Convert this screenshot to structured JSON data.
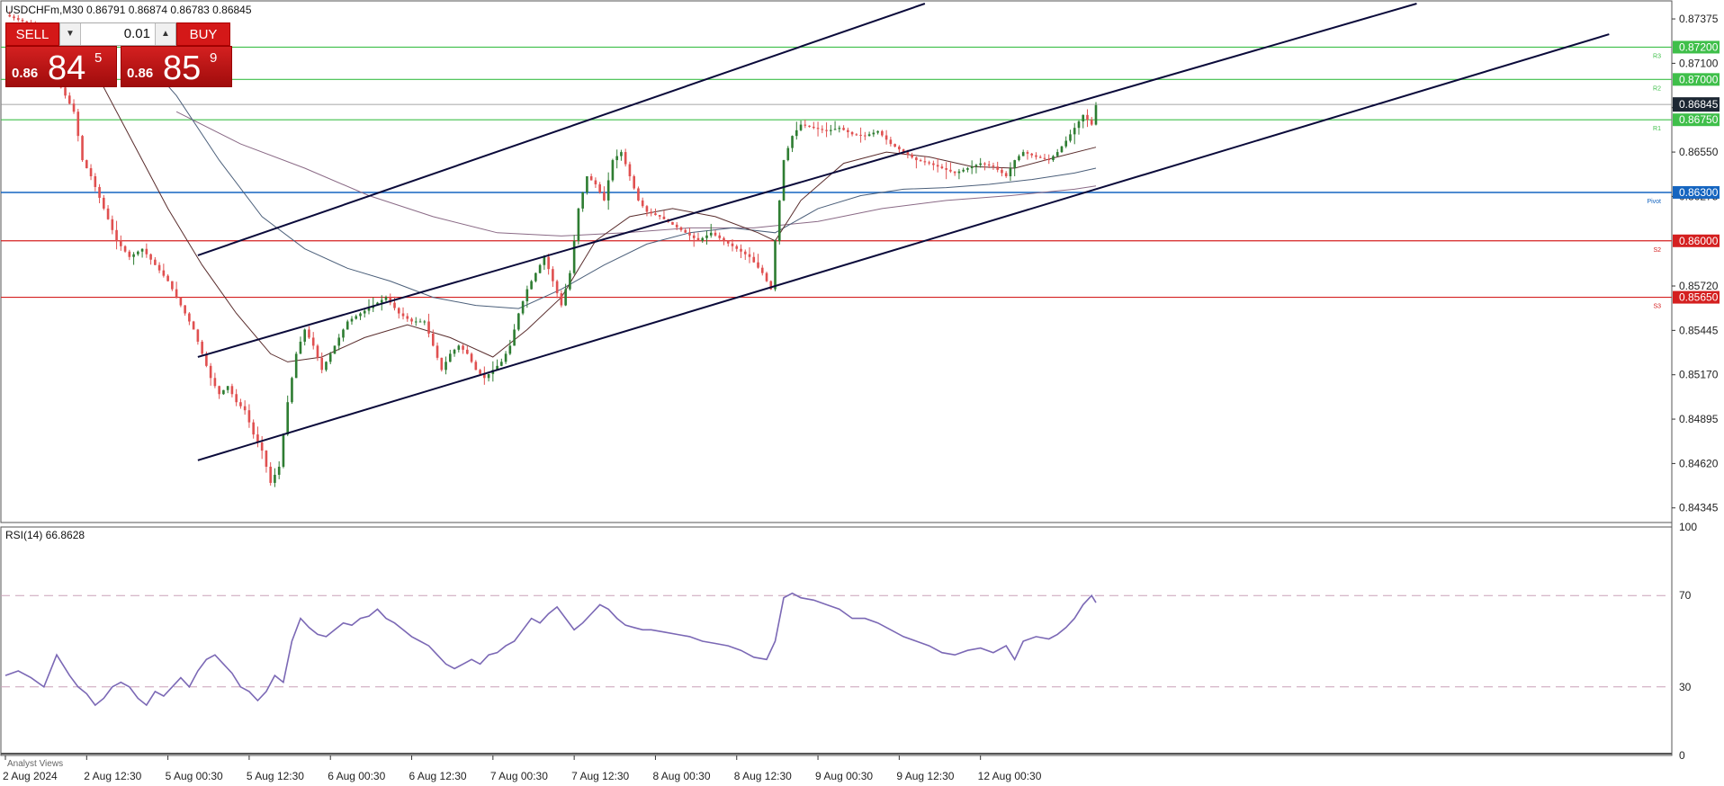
{
  "header": {
    "symbol_line": "USDCHFm,M30  0.86791 0.86874 0.86783 0.86845"
  },
  "trade_panel": {
    "sell_label": "SELL",
    "buy_label": "BUY",
    "lot_value": "0.01",
    "bid_small": "0.86",
    "bid_big": "84",
    "bid_sup": "5",
    "ask_small": "0.86",
    "ask_big": "85",
    "ask_sup": "9"
  },
  "rsi_panel": {
    "title": "RSI(14) 66.8628"
  },
  "footer": {
    "analyst_label": "Analyst Views"
  },
  "colors": {
    "bull": "#2e7d32",
    "bear": "#e05050",
    "resistance": "#3fbf4a",
    "support": "#d42020",
    "pivot": "#1565c0",
    "rsi": "#7b68b5",
    "channel": "#0a0a3a"
  },
  "chart_data": [
    {
      "type": "candlestick",
      "symbol": "USDCHFm",
      "timeframe": "M30",
      "ylim": [
        0.8426,
        0.8747
      ],
      "y_ticks": [
        "0.87375",
        "0.87100",
        "0.86825",
        "0.86550",
        "0.86275",
        "0.85720",
        "0.85445",
        "0.85170",
        "0.84895",
        "0.84620",
        "0.84345"
      ],
      "x_ticks": [
        "2 Aug 2024",
        "2 Aug 12:30",
        "5 Aug 00:30",
        "5 Aug 12:30",
        "6 Aug 00:30",
        "6 Aug 12:30",
        "7 Aug 00:30",
        "7 Aug 12:30",
        "8 Aug 00:30",
        "8 Aug 12:30",
        "9 Aug 00:30",
        "9 Aug 12:30",
        "12 Aug 00:30"
      ],
      "current_price": "0.86845",
      "levels": [
        {
          "name": "R3",
          "price": 0.872,
          "label": "0.87200",
          "role": "resistance"
        },
        {
          "name": "R2",
          "price": 0.87,
          "label": "0.87000",
          "role": "resistance"
        },
        {
          "name": "R1",
          "price": 0.8675,
          "label": "0.86750",
          "role": "resistance"
        },
        {
          "name": "Pivot",
          "price": 0.863,
          "label": "0.86300",
          "role": "pivot"
        },
        {
          "name": "S2",
          "price": 0.86,
          "label": "0.86000",
          "role": "support"
        },
        {
          "name": "S3",
          "price": 0.8565,
          "label": "0.85650",
          "role": "support"
        }
      ],
      "close_path": [
        [
          0,
          0.874
        ],
        [
          2,
          0.8738
        ],
        [
          4,
          0.8736
        ],
        [
          6,
          0.8734
        ],
        [
          8,
          0.8732
        ],
        [
          10,
          0.873
        ],
        [
          12,
          0.87
        ],
        [
          14,
          0.869
        ],
        [
          16,
          0.868
        ],
        [
          18,
          0.865
        ],
        [
          20,
          0.864
        ],
        [
          23,
          0.862
        ],
        [
          26,
          0.86
        ],
        [
          29,
          0.859
        ],
        [
          32,
          0.8595
        ],
        [
          35,
          0.8585
        ],
        [
          38,
          0.8575
        ],
        [
          41,
          0.856
        ],
        [
          44,
          0.8545
        ],
        [
          46,
          0.853
        ],
        [
          48,
          0.8515
        ],
        [
          50,
          0.8505
        ],
        [
          52,
          0.851
        ],
        [
          54,
          0.85
        ],
        [
          56,
          0.8495
        ],
        [
          58,
          0.848
        ],
        [
          60,
          0.847
        ],
        [
          62,
          0.845
        ],
        [
          64,
          0.846
        ],
        [
          66,
          0.85
        ],
        [
          68,
          0.853
        ],
        [
          70,
          0.8545
        ],
        [
          72,
          0.8535
        ],
        [
          74,
          0.852
        ],
        [
          76,
          0.853
        ],
        [
          78,
          0.854
        ],
        [
          80,
          0.855
        ],
        [
          83,
          0.8555
        ],
        [
          86,
          0.856
        ],
        [
          89,
          0.8565
        ],
        [
          92,
          0.8555
        ],
        [
          95,
          0.855
        ],
        [
          98,
          0.855
        ],
        [
          100,
          0.8535
        ],
        [
          102,
          0.852
        ],
        [
          104,
          0.853
        ],
        [
          106,
          0.8535
        ],
        [
          108,
          0.853
        ],
        [
          110,
          0.852
        ],
        [
          112,
          0.8515
        ],
        [
          114,
          0.852
        ],
        [
          116,
          0.8525
        ],
        [
          118,
          0.8535
        ],
        [
          120,
          0.8555
        ],
        [
          122,
          0.857
        ],
        [
          124,
          0.858
        ],
        [
          126,
          0.859
        ],
        [
          128,
          0.8575
        ],
        [
          130,
          0.856
        ],
        [
          132,
          0.858
        ],
        [
          134,
          0.862
        ],
        [
          136,
          0.864
        ],
        [
          138,
          0.8635
        ],
        [
          140,
          0.8625
        ],
        [
          142,
          0.865
        ],
        [
          144,
          0.8655
        ],
        [
          146,
          0.864
        ],
        [
          148,
          0.8625
        ],
        [
          150,
          0.8618
        ],
        [
          153,
          0.8615
        ],
        [
          156,
          0.861
        ],
        [
          159,
          0.8605
        ],
        [
          162,
          0.86
        ],
        [
          165,
          0.8605
        ],
        [
          168,
          0.86
        ],
        [
          171,
          0.8595
        ],
        [
          174,
          0.859
        ],
        [
          177,
          0.858
        ],
        [
          179,
          0.857
        ],
        [
          180,
          0.86
        ],
        [
          182,
          0.865
        ],
        [
          184,
          0.8665
        ],
        [
          186,
          0.8672
        ],
        [
          189,
          0.867
        ],
        [
          192,
          0.8668
        ],
        [
          195,
          0.867
        ],
        [
          198,
          0.8666
        ],
        [
          201,
          0.8665
        ],
        [
          204,
          0.8668
        ],
        [
          207,
          0.866
        ],
        [
          210,
          0.8655
        ],
        [
          213,
          0.865
        ],
        [
          216,
          0.8648
        ],
        [
          219,
          0.8645
        ],
        [
          222,
          0.8642
        ],
        [
          225,
          0.8645
        ],
        [
          228,
          0.8648
        ],
        [
          231,
          0.8646
        ],
        [
          234,
          0.864
        ],
        [
          236,
          0.865
        ],
        [
          238,
          0.8655
        ],
        [
          241,
          0.8652
        ],
        [
          244,
          0.865
        ],
        [
          246,
          0.8655
        ],
        [
          248,
          0.8662
        ],
        [
          250,
          0.867
        ],
        [
          252,
          0.8678
        ],
        [
          254,
          0.8672
        ],
        [
          255,
          0.8684
        ]
      ],
      "x_range": [
        0,
        255
      ],
      "ma_fast": [
        [
          14,
          0.8728
        ],
        [
          22,
          0.87
        ],
        [
          30,
          0.866
        ],
        [
          38,
          0.862
        ],
        [
          46,
          0.8585
        ],
        [
          54,
          0.8555
        ],
        [
          62,
          0.853
        ],
        [
          66,
          0.8525
        ],
        [
          74,
          0.8528
        ],
        [
          84,
          0.854
        ],
        [
          94,
          0.8548
        ],
        [
          104,
          0.854
        ],
        [
          114,
          0.8528
        ],
        [
          122,
          0.8545
        ],
        [
          130,
          0.8565
        ],
        [
          138,
          0.86
        ],
        [
          146,
          0.8615
        ],
        [
          156,
          0.862
        ],
        [
          166,
          0.8615
        ],
        [
          176,
          0.8605
        ],
        [
          180,
          0.86
        ],
        [
          186,
          0.8625
        ],
        [
          196,
          0.8648
        ],
        [
          206,
          0.8655
        ],
        [
          216,
          0.8652
        ],
        [
          226,
          0.8646
        ],
        [
          236,
          0.8645
        ],
        [
          246,
          0.8652
        ],
        [
          255,
          0.8658
        ]
      ],
      "ma_mid": [
        [
          30,
          0.872
        ],
        [
          40,
          0.869
        ],
        [
          50,
          0.865
        ],
        [
          60,
          0.8615
        ],
        [
          70,
          0.8595
        ],
        [
          80,
          0.8583
        ],
        [
          90,
          0.8575
        ],
        [
          100,
          0.8565
        ],
        [
          110,
          0.856
        ],
        [
          120,
          0.8558
        ],
        [
          130,
          0.857
        ],
        [
          140,
          0.8585
        ],
        [
          150,
          0.8598
        ],
        [
          160,
          0.8605
        ],
        [
          170,
          0.8608
        ],
        [
          180,
          0.8605
        ],
        [
          190,
          0.862
        ],
        [
          200,
          0.8628
        ],
        [
          210,
          0.8632
        ],
        [
          220,
          0.8633
        ],
        [
          230,
          0.8635
        ],
        [
          240,
          0.8638
        ],
        [
          250,
          0.8642
        ],
        [
          255,
          0.8645
        ]
      ],
      "ma_slow": [
        [
          40,
          0.868
        ],
        [
          55,
          0.866
        ],
        [
          70,
          0.8645
        ],
        [
          85,
          0.8628
        ],
        [
          100,
          0.8615
        ],
        [
          115,
          0.8605
        ],
        [
          130,
          0.8603
        ],
        [
          145,
          0.8605
        ],
        [
          160,
          0.8608
        ],
        [
          175,
          0.8608
        ],
        [
          190,
          0.8612
        ],
        [
          205,
          0.862
        ],
        [
          220,
          0.8625
        ],
        [
          235,
          0.8628
        ],
        [
          250,
          0.8632
        ],
        [
          255,
          0.8634
        ]
      ],
      "channel_lines": [
        {
          "from": [
            45,
            0.8591
          ],
          "to": [
            215,
            0.8747
          ]
        },
        {
          "from": [
            45,
            0.8528
          ],
          "to": [
            330,
            0.8747
          ]
        },
        {
          "from": [
            45,
            0.8464
          ],
          "to": [
            375,
            0.8728
          ]
        }
      ]
    },
    {
      "type": "line",
      "indicator": "RSI(14)",
      "current_value": 66.8628,
      "ylim": [
        0,
        100
      ],
      "y_ticks": [
        "100",
        "70",
        "30",
        "0"
      ],
      "levels": [
        70,
        30
      ],
      "x_range": [
        0,
        255
      ],
      "values": [
        [
          0,
          35
        ],
        [
          3,
          37
        ],
        [
          6,
          34
        ],
        [
          9,
          30
        ],
        [
          12,
          44
        ],
        [
          15,
          35
        ],
        [
          17,
          30
        ],
        [
          19,
          27
        ],
        [
          21,
          22
        ],
        [
          23,
          25
        ],
        [
          25,
          30
        ],
        [
          27,
          32
        ],
        [
          29,
          30
        ],
        [
          31,
          25
        ],
        [
          33,
          22
        ],
        [
          35,
          28
        ],
        [
          37,
          26
        ],
        [
          39,
          30
        ],
        [
          41,
          34
        ],
        [
          43,
          30
        ],
        [
          45,
          37
        ],
        [
          47,
          42
        ],
        [
          49,
          44
        ],
        [
          51,
          40
        ],
        [
          53,
          36
        ],
        [
          55,
          30
        ],
        [
          57,
          28
        ],
        [
          59,
          24
        ],
        [
          61,
          28
        ],
        [
          63,
          35
        ],
        [
          65,
          32
        ],
        [
          67,
          50
        ],
        [
          69,
          60
        ],
        [
          71,
          56
        ],
        [
          73,
          53
        ],
        [
          75,
          52
        ],
        [
          77,
          55
        ],
        [
          79,
          58
        ],
        [
          81,
          57
        ],
        [
          83,
          60
        ],
        [
          85,
          61
        ],
        [
          87,
          64
        ],
        [
          89,
          60
        ],
        [
          91,
          58
        ],
        [
          93,
          55
        ],
        [
          95,
          52
        ],
        [
          97,
          50
        ],
        [
          99,
          48
        ],
        [
          101,
          44
        ],
        [
          103,
          40
        ],
        [
          105,
          38
        ],
        [
          107,
          40
        ],
        [
          109,
          42
        ],
        [
          111,
          40
        ],
        [
          113,
          44
        ],
        [
          115,
          45
        ],
        [
          117,
          48
        ],
        [
          119,
          50
        ],
        [
          121,
          55
        ],
        [
          123,
          60
        ],
        [
          125,
          58
        ],
        [
          127,
          62
        ],
        [
          129,
          65
        ],
        [
          131,
          60
        ],
        [
          133,
          55
        ],
        [
          135,
          58
        ],
        [
          137,
          62
        ],
        [
          139,
          66
        ],
        [
          141,
          64
        ],
        [
          143,
          60
        ],
        [
          145,
          57
        ],
        [
          147,
          56
        ],
        [
          149,
          55
        ],
        [
          151,
          55
        ],
        [
          154,
          54
        ],
        [
          157,
          53
        ],
        [
          160,
          52
        ],
        [
          163,
          50
        ],
        [
          166,
          49
        ],
        [
          169,
          48
        ],
        [
          172,
          46
        ],
        [
          175,
          43
        ],
        [
          178,
          42
        ],
        [
          180,
          50
        ],
        [
          182,
          69
        ],
        [
          184,
          71
        ],
        [
          186,
          69
        ],
        [
          189,
          68
        ],
        [
          192,
          66
        ],
        [
          195,
          64
        ],
        [
          198,
          60
        ],
        [
          201,
          60
        ],
        [
          204,
          58
        ],
        [
          207,
          55
        ],
        [
          210,
          52
        ],
        [
          213,
          50
        ],
        [
          216,
          48
        ],
        [
          219,
          45
        ],
        [
          222,
          44
        ],
        [
          225,
          46
        ],
        [
          228,
          47
        ],
        [
          231,
          45
        ],
        [
          234,
          48
        ],
        [
          236,
          42
        ],
        [
          238,
          50
        ],
        [
          241,
          52
        ],
        [
          244,
          51
        ],
        [
          246,
          53
        ],
        [
          248,
          56
        ],
        [
          250,
          60
        ],
        [
          252,
          66
        ],
        [
          254,
          70
        ],
        [
          255,
          66.9
        ]
      ]
    }
  ]
}
